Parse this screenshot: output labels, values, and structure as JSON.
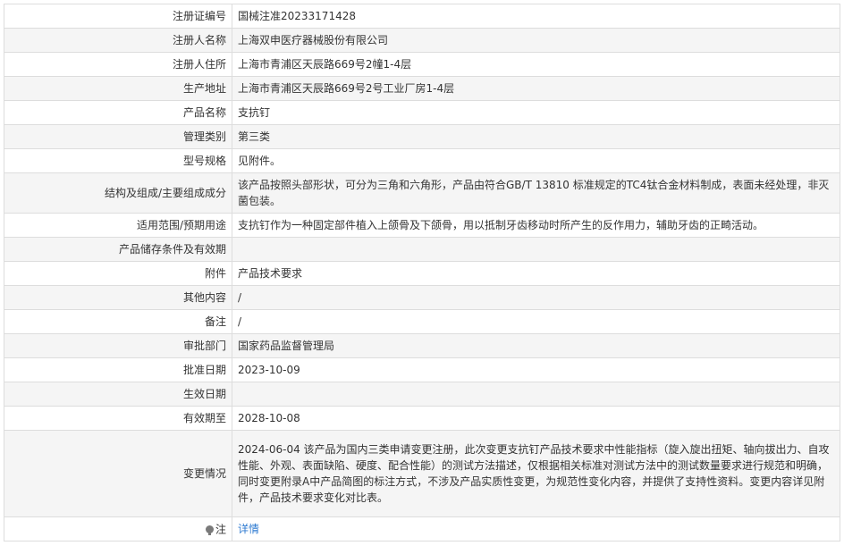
{
  "record": {
    "rows": [
      {
        "label": "注册证编号",
        "value": "国械注准20233171428"
      },
      {
        "label": "注册人名称",
        "value": "上海双申医疗器械股份有限公司"
      },
      {
        "label": "注册人住所",
        "value": "上海市青浦区天辰路669号2幢1-4层"
      },
      {
        "label": "生产地址",
        "value": "上海市青浦区天辰路669号2号工业厂房1-4层"
      },
      {
        "label": "产品名称",
        "value": "支抗钉"
      },
      {
        "label": "管理类别",
        "value": "第三类"
      },
      {
        "label": "型号规格",
        "value": "见附件。"
      },
      {
        "label": "结构及组成/主要组成成分",
        "value": "该产品按照头部形状，可分为三角和六角形，产品由符合GB/T 13810 标准规定的TC4钛合金材料制成，表面未经处理，非灭菌包装。"
      },
      {
        "label": "适用范围/预期用途",
        "value": "支抗钉作为一种固定部件植入上颌骨及下颌骨，用以抵制牙齿移动时所产生的反作用力，辅助牙齿的正畸活动。"
      },
      {
        "label": "产品储存条件及有效期",
        "value": ""
      },
      {
        "label": "附件",
        "value": "产品技术要求"
      },
      {
        "label": "其他内容",
        "value": "/"
      },
      {
        "label": "备注",
        "value": "/"
      },
      {
        "label": "审批部门",
        "value": "国家药品监督管理局"
      },
      {
        "label": "批准日期",
        "value": "2023-10-09"
      },
      {
        "label": "生效日期",
        "value": ""
      },
      {
        "label": "有效期至",
        "value": "2028-10-08"
      },
      {
        "label": "变更情况",
        "value": "2024-06-04 该产品为国内三类申请变更注册，此次变更支抗钉产品技术要求中性能指标（旋入旋出扭矩、轴向拔出力、自攻性能、外观、表面缺陷、硬度、配合性能）的测试方法描述，仅根据相关标准对测试方法中的测试数量要求进行规范和明确，同时变更附录A中产品简图的标注方式，不涉及产品实质性变更，为规范性变化内容，并提供了支持性资料。变更内容详见附件，产品技术要求变化对比表。"
      }
    ],
    "note": {
      "icon": "lightbulb-icon",
      "label": "注",
      "link_text": "详情",
      "link_color": "#2f7bd1"
    }
  }
}
